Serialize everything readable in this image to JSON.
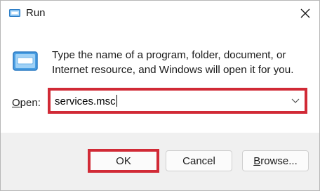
{
  "window": {
    "title": "Run",
    "close_icon": "close-icon",
    "app_icon": "run-icon"
  },
  "body": {
    "description": "Type the name of a program, folder, document, or Internet resource, and Windows will open it for you.",
    "open_label_accel": "O",
    "open_label_rest": "pen:",
    "open_value": "services.msc",
    "dropdown_icon": "chevron-down-icon"
  },
  "buttons": {
    "ok": "OK",
    "cancel": "Cancel",
    "browse_accel": "B",
    "browse_rest": "rowse..."
  },
  "colors": {
    "highlight": "#d12a36",
    "footer_bg": "#f0f0f0",
    "icon_blue": "#3a8ed8"
  }
}
